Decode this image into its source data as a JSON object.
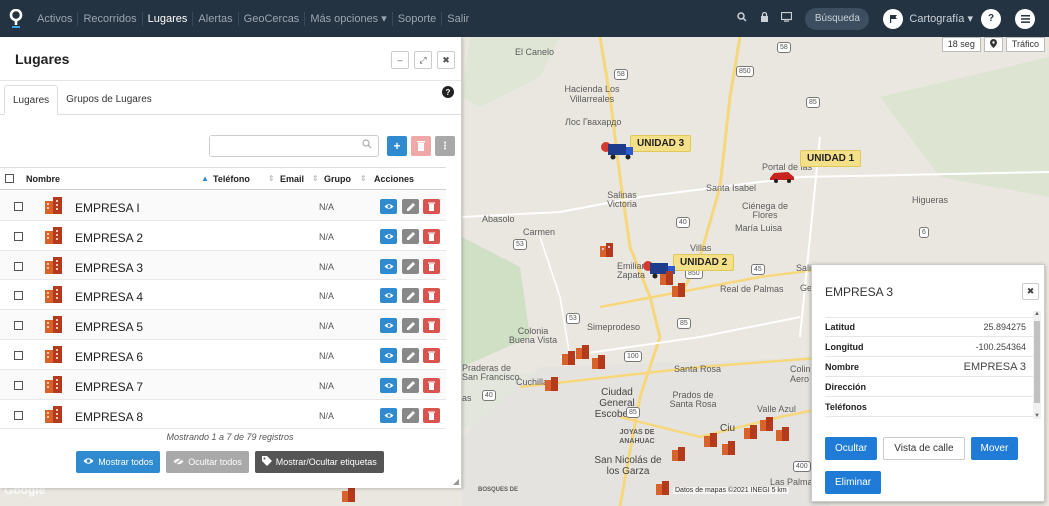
{
  "nav": {
    "items": [
      "Activos",
      "Recorridos",
      "Lugares",
      "Alertas",
      "GeoCercas",
      "Más opciones ▾",
      "Soporte",
      "Salir"
    ],
    "active": "Lugares",
    "search_label": "Búsqueda",
    "cartography_label": "Cartografía ▾"
  },
  "map": {
    "labels": [
      "El Canelo",
      "Hacienda Los Villarreales",
      "Лос Гвахардо",
      "Salinas Victoria",
      "Santa Isabel",
      "Ciénega de Flores",
      "María Luisa",
      "Higueras",
      "Abasolo",
      "Carmen",
      "Portal de las",
      "Emiliano Zapata",
      "Villas",
      "Real de Palmas",
      "Simeprodeso",
      "Colonia Buena Vista",
      "Praderas de San Francisco",
      "Cuchilla",
      "Santa Rosa",
      "Ciudad General Escobedo",
      "Prados de Santa Rosa",
      "Valle Azul",
      "JOYAS DE ANAHUAC",
      "San Nicolás de los Garza",
      "BOSQUES DE",
      "Las Palmas",
      "Colin",
      "Aero",
      "Sali",
      "Ge",
      "Ciu",
      "as"
    ],
    "route_shields": [
      "58",
      "850",
      "85",
      "58",
      "40",
      "53",
      "850",
      "45",
      "53",
      "85",
      "100",
      "40",
      "85",
      "400",
      "6"
    ],
    "units": [
      "UNIDAD 3",
      "UNIDAD 1",
      "UNIDAD 2"
    ],
    "timer": "18 seg",
    "traffic": "Tráfico",
    "credit": "Datos de mapas ©2021 INEGI  5 km",
    "watermark": "Google"
  },
  "panel": {
    "title": "Lugares",
    "tabs": [
      "Lugares",
      "Grupos de Lugares"
    ],
    "columns": {
      "name": "Nombre",
      "phone": "Teléfono",
      "email": "Email",
      "group": "Grupo",
      "actions": "Acciones"
    },
    "rows": [
      {
        "name": "EMPRESA  I",
        "group": "N/A"
      },
      {
        "name": "EMPRESA 2",
        "group": "N/A"
      },
      {
        "name": "EMPRESA 3",
        "group": "N/A"
      },
      {
        "name": "EMPRESA 4",
        "group": "N/A"
      },
      {
        "name": "EMPRESA 5",
        "group": "N/A"
      },
      {
        "name": "EMPRESA 6",
        "group": "N/A"
      },
      {
        "name": "EMPRESA 7",
        "group": "N/A"
      },
      {
        "name": "EMPRESA 8",
        "group": "N/A"
      }
    ],
    "showing": "Mostrando 1 a 7 de 79 registros",
    "btn_show_all": "Mostrar todos",
    "btn_hide_all": "Ocultar todos",
    "btn_tags": "Mostrar/Ocultar etiquetas"
  },
  "popup": {
    "title": "EMPRESA 3",
    "fields": [
      {
        "label": "Latitud",
        "value": "25.894275"
      },
      {
        "label": "Longitud",
        "value": "-100.254364"
      },
      {
        "label": "Nombre",
        "value": "EMPRESA 3"
      },
      {
        "label": "Dirección",
        "value": ""
      },
      {
        "label": "Teléfonos",
        "value": ""
      }
    ],
    "btn_hide": "Ocultar",
    "btn_street": "Vista de calle",
    "btn_move": "Mover",
    "btn_delete": "Eliminar"
  },
  "colors": {
    "navbar": "#243341",
    "primary": "#2f8ad0",
    "danger": "#d9534f",
    "unit_label": "#f5e08a"
  }
}
